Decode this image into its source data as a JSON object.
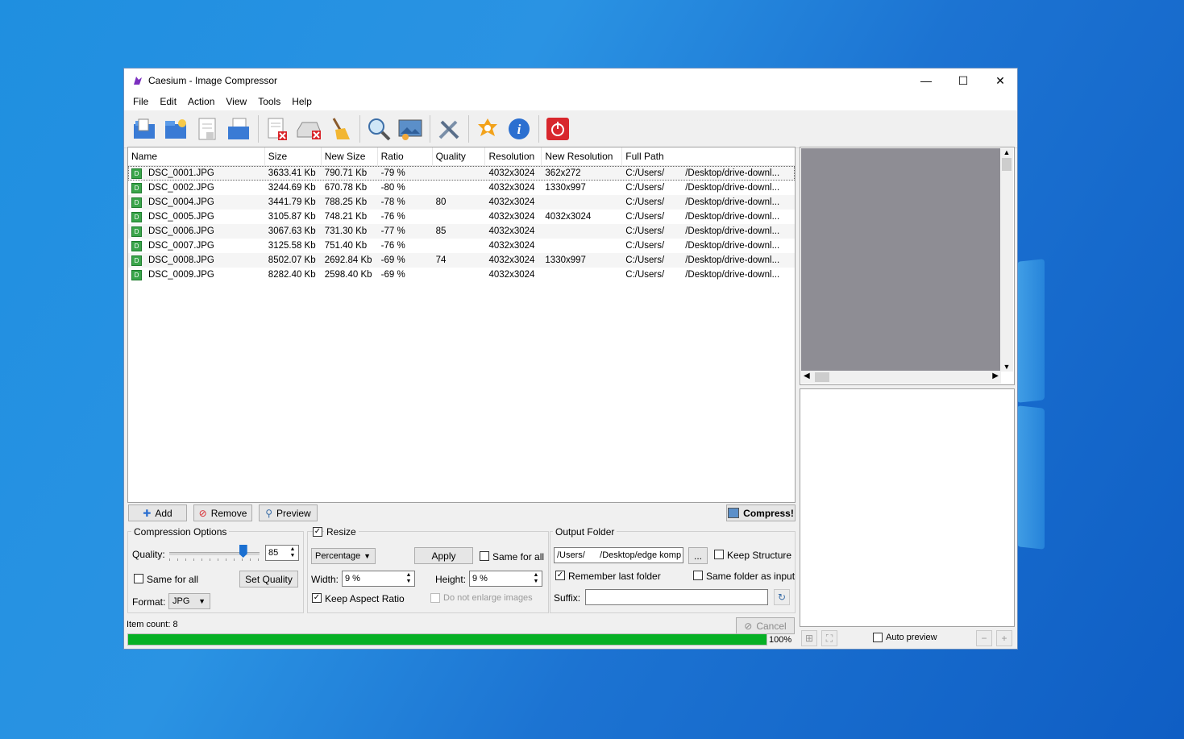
{
  "window": {
    "title": "Caesium - Image Compressor",
    "controls": {
      "minimize": "—",
      "maximize": "☐",
      "close": "✕"
    }
  },
  "menu": [
    "File",
    "Edit",
    "Action",
    "View",
    "Tools",
    "Help"
  ],
  "toolbar": {
    "icons": [
      "open-files-icon",
      "open-folder-icon",
      "save-list-icon",
      "open-list-icon",
      "remove-item-icon",
      "clear-list-icon",
      "clean-icon",
      "zoom-icon",
      "preview-image-icon",
      "settings-icon",
      "update-icon",
      "info-icon",
      "exit-icon"
    ]
  },
  "table": {
    "columns": [
      "Name",
      "Size",
      "New Size",
      "Ratio",
      "Quality",
      "Resolution",
      "New Resolution",
      "Full Path"
    ],
    "rows": [
      {
        "name": "DSC_0001.JPG",
        "size": "3633.41 Kb",
        "new_size": "790.71 Kb",
        "ratio": "-79 %",
        "quality": "",
        "resolution": "4032x3024",
        "new_resolution": "362x272",
        "path1": "C:/Users/",
        "path2": "/Desktop/drive-downl..."
      },
      {
        "name": "DSC_0002.JPG",
        "size": "3244.69 Kb",
        "new_size": "670.78 Kb",
        "ratio": "-80 %",
        "quality": "",
        "resolution": "4032x3024",
        "new_resolution": "1330x997",
        "path1": "C:/Users/",
        "path2": "/Desktop/drive-downl..."
      },
      {
        "name": "DSC_0004.JPG",
        "size": "3441.79 Kb",
        "new_size": "788.25 Kb",
        "ratio": "-78 %",
        "quality": "80",
        "resolution": "4032x3024",
        "new_resolution": "",
        "path1": "C:/Users/",
        "path2": "/Desktop/drive-downl..."
      },
      {
        "name": "DSC_0005.JPG",
        "size": "3105.87 Kb",
        "new_size": "748.21 Kb",
        "ratio": "-76 %",
        "quality": "",
        "resolution": "4032x3024",
        "new_resolution": "4032x3024",
        "path1": "C:/Users/",
        "path2": "/Desktop/drive-downl..."
      },
      {
        "name": "DSC_0006.JPG",
        "size": "3067.63 Kb",
        "new_size": "731.30 Kb",
        "ratio": "-77 %",
        "quality": "85",
        "resolution": "4032x3024",
        "new_resolution": "",
        "path1": "C:/Users/",
        "path2": "/Desktop/drive-downl..."
      },
      {
        "name": "DSC_0007.JPG",
        "size": "3125.58 Kb",
        "new_size": "751.40 Kb",
        "ratio": "-76 %",
        "quality": "",
        "resolution": "4032x3024",
        "new_resolution": "",
        "path1": "C:/Users/",
        "path2": "/Desktop/drive-downl..."
      },
      {
        "name": "DSC_0008.JPG",
        "size": "8502.07 Kb",
        "new_size": "2692.84 Kb",
        "ratio": "-69 %",
        "quality": "74",
        "resolution": "4032x3024",
        "new_resolution": "1330x997",
        "path1": "C:/Users/",
        "path2": "/Desktop/drive-downl..."
      },
      {
        "name": "DSC_0009.JPG",
        "size": "8282.40 Kb",
        "new_size": "2598.40 Kb",
        "ratio": "-69 %",
        "quality": "",
        "resolution": "4032x3024",
        "new_resolution": "",
        "path1": "C:/Users/",
        "path2": "/Desktop/drive-downl..."
      }
    ]
  },
  "buttons": {
    "add": "Add",
    "remove": "Remove",
    "preview": "Preview",
    "compress": "Compress!",
    "cancel": "Cancel"
  },
  "compression": {
    "title": "Compression Options",
    "quality_label": "Quality:",
    "quality_value": "85",
    "quality_slider_level": 0.85,
    "same_for_all": "Same for all",
    "set_quality": "Set Quality",
    "format_label": "Format:",
    "format_value": "JPG"
  },
  "resize": {
    "title": "Resize",
    "mode": "Percentage",
    "apply": "Apply",
    "same_for_all": "Same for all",
    "width_label": "Width:",
    "width_value": "9 %",
    "height_label": "Height:",
    "height_value": "9 %",
    "keep_aspect": "Keep Aspect Ratio",
    "no_enlarge": "Do not enlarge images"
  },
  "output": {
    "title": "Output Folder",
    "folder_value": "/Users/      /Desktop/edge komp",
    "browse": "...",
    "keep_structure": "Keep Structure",
    "remember_last": "Remember last folder",
    "same_as_input": "Same folder as input",
    "suffix_label": "Suffix:",
    "suffix_value": ""
  },
  "status": {
    "item_count": "Item count: 8",
    "progress_text": "100%",
    "progress_value": 1.0
  },
  "preview": {
    "auto_preview": "Auto preview"
  }
}
